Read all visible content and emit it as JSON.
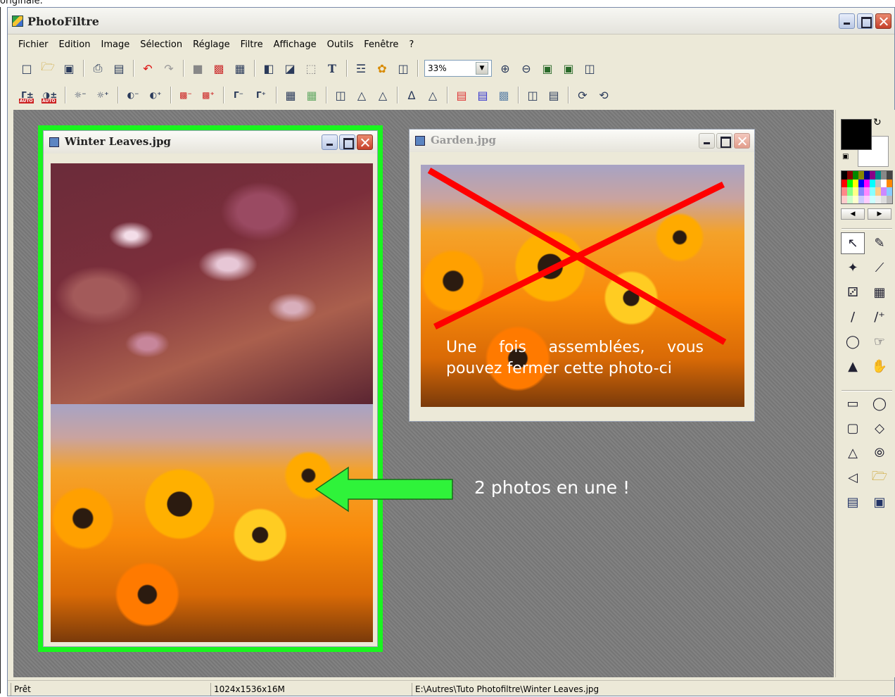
{
  "doc_fragment": "originale.",
  "app": {
    "title": "PhotoFiltre"
  },
  "menu": [
    "Fichier",
    "Edition",
    "Image",
    "Sélection",
    "Réglage",
    "Filtre",
    "Affichage",
    "Outils",
    "Fenêtre",
    "?"
  ],
  "toolbar": {
    "zoom_value": "33%"
  },
  "windows": {
    "winter": {
      "title": "Winter Leaves.jpg"
    },
    "garden": {
      "title": "Garden.jpg"
    }
  },
  "overlay_note": {
    "line1": "Une fois assemblées, vous",
    "line2": "pouvez fermer cette photo-ci"
  },
  "annotation": "2 photos en une !",
  "status": {
    "state": "Prêt",
    "dimensions": "1024x1536x16M",
    "path": "E:\\Autres\\Tuto Photofiltre\\Winter Leaves.jpg"
  },
  "colors": {
    "highlight_frame": "#19f51f",
    "cross": "#ff0000",
    "arrow": "#2ff33a"
  },
  "icons": {
    "toolbar1": [
      "new-icon",
      "open-icon",
      "save-icon",
      "print-icon",
      "scan-icon",
      "undo-icon",
      "redo-icon",
      "fill-icon",
      "color-grid-icon",
      "transform-icon",
      "image-size-icon",
      "canvas-size-icon",
      "select-icon",
      "text-icon",
      "tree-icon",
      "sun-icon",
      "window-icon",
      "zoom-in-icon",
      "zoom-out-icon",
      "fit-icon",
      "fullscreen-icon",
      "slideshow-icon"
    ],
    "toolbar2": [
      "auto-levels-icon",
      "auto-contrast-icon",
      "brightness-minus-icon",
      "brightness-plus-icon",
      "contrast-minus-icon",
      "contrast-plus-icon",
      "saturation-minus-icon",
      "saturation-plus-icon",
      "gamma-minus-icon",
      "gamma-plus-icon",
      "grid-icon",
      "grid2-icon",
      "blur-icon",
      "drop-icon",
      "drop2-icon",
      "sharpen-icon",
      "sharpen2-icon",
      "gradient-icon",
      "rgb-icon",
      "brush-effect-icon",
      "flip-horizontal-icon",
      "flip-vertical-icon",
      "rotate-icon",
      "rotate2-icon"
    ],
    "tools": [
      "pointer-icon",
      "eyedropper-icon",
      "magic-wand-icon",
      "line-icon",
      "fill-bucket-icon",
      "spray-icon",
      "brush-icon",
      "advanced-brush-icon",
      "blur-drop-icon",
      "smudge-icon",
      "stamp-icon",
      "hand-icon"
    ],
    "shapes": [
      "rectangle-icon",
      "ellipse-icon",
      "rounded-rect-icon",
      "diamond-icon",
      "triangle-icon",
      "lasso-icon",
      "polygon-lasso-icon",
      "open-shape-icon",
      "select-all-icon",
      "invert-select-icon"
    ]
  }
}
